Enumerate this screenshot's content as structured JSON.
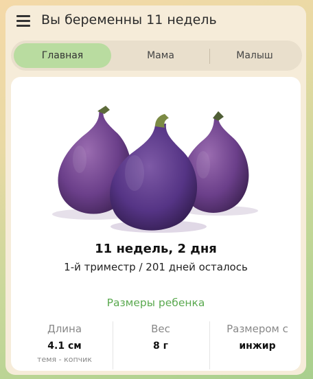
{
  "header": {
    "title": "Вы беременны 11 недель"
  },
  "tabs": [
    {
      "label": "Главная",
      "active": true
    },
    {
      "label": "Мама",
      "active": false
    },
    {
      "label": "Малыш",
      "active": false
    }
  ],
  "main": {
    "image": "fig-image",
    "weeks_text": "11 недель, 2 дня",
    "trimester_text": "1-й триместр / 201 дней осталось",
    "sizes_title": "Размеры ребенка",
    "metrics": [
      {
        "label": "Длина",
        "value": "4.1 см",
        "sub": "темя - копчик"
      },
      {
        "label": "Вес",
        "value": "8 г",
        "sub": ""
      },
      {
        "label": "Размером с",
        "value": "инжир",
        "sub": ""
      }
    ]
  },
  "colors": {
    "accent_green": "#5aa94f",
    "active_tab": "#b9dca0",
    "panel": "#f6ecd9"
  }
}
